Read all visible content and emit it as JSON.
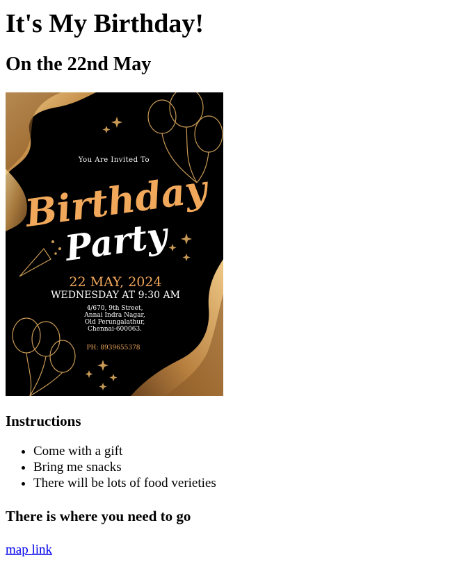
{
  "page": {
    "title": "It's My Birthday!",
    "subtitle": "On the 22nd May"
  },
  "poster": {
    "invited_line": "You Are Invited To",
    "title_word_1": "Birthday",
    "title_word_2": "Party",
    "date": "22 MAY, 2024",
    "day_time": "WEDNESDAY AT 9:30 AM",
    "address": [
      "4/670, 9th Street,",
      "Annai Indra Nagar,",
      "Old Perungalathur,",
      "Chennai-600063."
    ],
    "phone": "PH: 8939655378",
    "colors": {
      "background": "#000000",
      "gold": "#c89a55",
      "orange_script": "#f2a85a",
      "white": "#ffffff"
    }
  },
  "instructions": {
    "heading": "Instructions",
    "items": [
      "Come with a gift",
      "Bring me snacks",
      "There will be lots of food verieties"
    ]
  },
  "where": {
    "heading": "There is where you need to go",
    "link_text": "map link"
  }
}
